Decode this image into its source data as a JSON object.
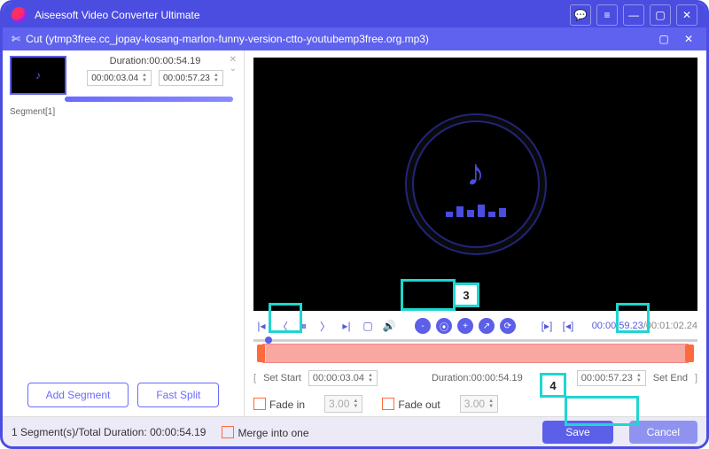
{
  "titlebar": {
    "app_name": "Aiseesoft Video Converter Ultimate"
  },
  "subbar": {
    "title": "Cut (ytmp3free.cc_jopay-kosang-marlon-funny-version-ctto-youtubemp3free.org.mp3)"
  },
  "segment": {
    "duration_label": "Duration:00:00:54.19",
    "start": "00:00:03.04",
    "end": "00:00:57.23",
    "label": "Segment[1]"
  },
  "left_buttons": {
    "add": "Add Segment",
    "split": "Fast Split"
  },
  "controls": {
    "time_current": "00:00:59.23",
    "time_total": "00:01:02.24"
  },
  "time_row": {
    "set_start_label": "Set Start",
    "start_value": "00:00:03.04",
    "duration_label": "Duration:00:00:54.19",
    "end_value": "00:00:57.23",
    "set_end_label": "Set End"
  },
  "fade": {
    "in_label": "Fade in",
    "in_value": "3.00",
    "out_label": "Fade out",
    "out_value": "3.00"
  },
  "footer": {
    "summary": "1 Segment(s)/Total Duration: 00:00:54.19",
    "merge_label": "Merge into one",
    "save": "Save",
    "cancel": "Cancel"
  },
  "badges": {
    "b3": "3",
    "b4": "4"
  }
}
